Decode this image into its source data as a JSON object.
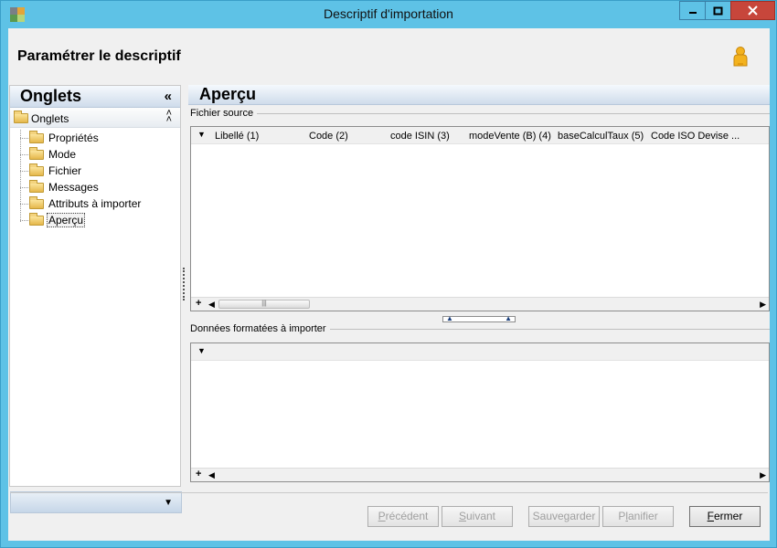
{
  "window": {
    "title": "Descriptif d'importation",
    "controls": {
      "minimize": "—",
      "maximize": "□",
      "close": "✕"
    }
  },
  "header": {
    "title": "Paramétrer le descriptif",
    "icon": "person-icon"
  },
  "left_pane": {
    "title": "Onglets",
    "collapse_glyph": "«",
    "group": {
      "label": "Onglets",
      "toggle_glyph": "˄\n˄"
    },
    "items": [
      {
        "label": "Propriétés",
        "icon": "folder-icon"
      },
      {
        "label": "Mode",
        "icon": "folder-icon"
      },
      {
        "label": "Fichier",
        "icon": "folder-icon"
      },
      {
        "label": "Messages",
        "icon": "folder-icon"
      },
      {
        "label": "Attributs à importer",
        "icon": "folder-icon"
      },
      {
        "label": "Aperçu",
        "icon": "folder-open-icon",
        "selected": true
      }
    ],
    "footer_glyph": "▼"
  },
  "right_pane": {
    "title": "Aperçu",
    "source": {
      "group_label": "Fichier source",
      "columns": [
        "Libellé (1)",
        "Code (2)",
        "code ISIN (3)",
        "modeVente (B) (4)",
        "baseCalculTaux (5)",
        "Code ISO Devise ..."
      ]
    },
    "formatted": {
      "group_label": "Données formatées à importer",
      "columns": []
    }
  },
  "footer_buttons": [
    {
      "label": "Précédent",
      "mnemonic": "P",
      "enabled": false
    },
    {
      "label": "Suivant",
      "mnemonic": "S",
      "enabled": false
    },
    {
      "label": "Sauvegarder",
      "mnemonic": "",
      "enabled": false
    },
    {
      "label": "Planifier",
      "mnemonic": "l",
      "enabled": false
    },
    {
      "label": "Fermer",
      "mnemonic": "F",
      "enabled": true
    }
  ],
  "colors": {
    "titlebar": "#5ec2e6",
    "close": "#c7463b",
    "header_gradient": "#cfdceb"
  }
}
